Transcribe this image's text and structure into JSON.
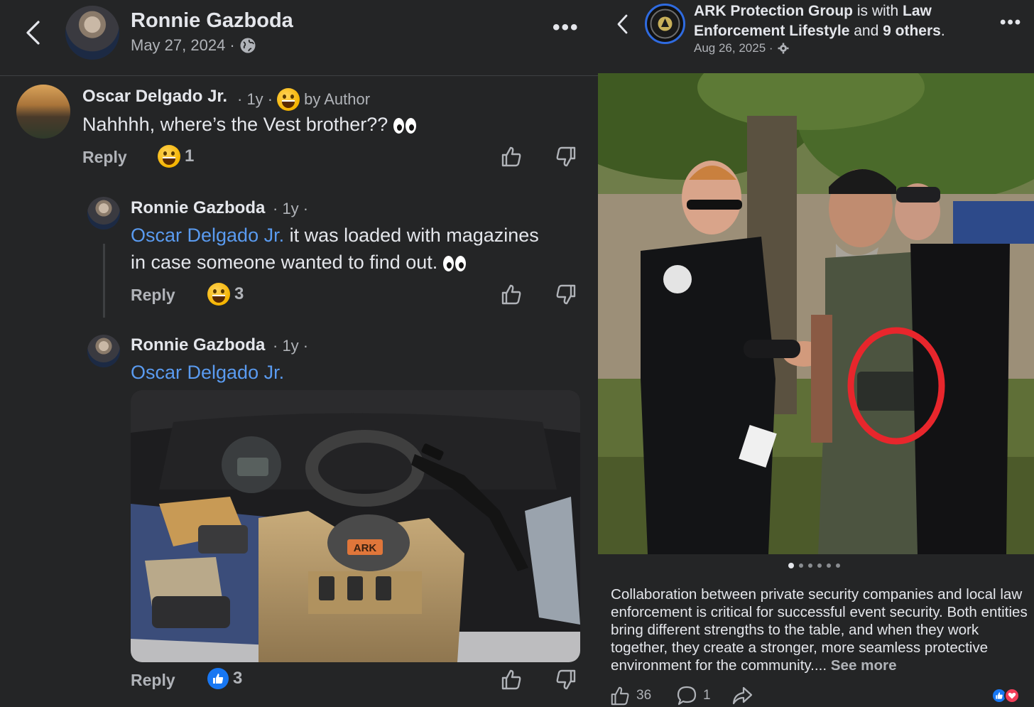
{
  "left": {
    "header": {
      "name": "Ronnie Gazboda",
      "date": "May 27, 2024 ·"
    },
    "comments": [
      {
        "author": "Oscar Delgado Jr.",
        "meta": "· 1y ·",
        "by_author": "by Author",
        "text": "Nahhhh, where’s the Vest brother??",
        "reply_label": "Reply",
        "reaction_count": "1"
      },
      {
        "author": "Ronnie Gazboda",
        "meta": "· 1y ·",
        "mention": "Oscar Delgado Jr.",
        "text_line1": " it was loaded with magazines",
        "text_line2": "in case someone wanted to find out.",
        "reply_label": "Reply",
        "reaction_count": "3"
      },
      {
        "author": "Ronnie Gazboda",
        "meta": "· 1y ·",
        "mention": "Oscar Delgado Jr.",
        "reply_label": "Reply",
        "reaction_count": "3",
        "photo_label": "ARK"
      }
    ]
  },
  "right": {
    "header": {
      "page_name": "ARK Protection Group",
      "is_with": " is with ",
      "tagged": "Law",
      "tagged2": "Enforcement Lifestyle",
      "and": " and ",
      "others": "9 others",
      "period": ".",
      "date": "Aug 26, 2025 ·"
    },
    "photo_dots": 6,
    "post_text": "Collaboration between private security companies and local law enforcement is critical for successful event security. Both entities bring different strengths to the table, and when they work together, they create a stronger, more seamless protective environment for the community.... ",
    "see_more": "See more",
    "likes": "36",
    "comments": "1",
    "colors": {
      "background": "#242526",
      "mention": "#5a9bf0",
      "like_blue": "#1877f2",
      "love_red": "#f33e58",
      "highlight_circle": "#e8262c"
    }
  }
}
